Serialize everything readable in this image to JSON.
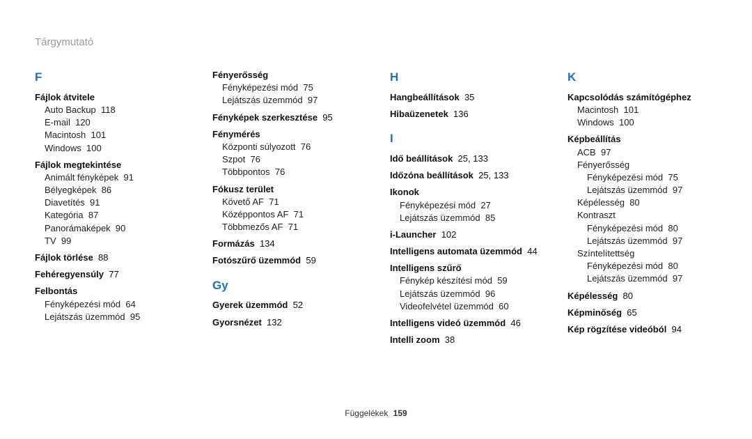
{
  "page_title": "Tárgymutató",
  "footer_label": "Függelékek",
  "footer_page": "159",
  "col1": {
    "letter": "F",
    "g1_head": "Fájlok átvitele",
    "g1_s1": "Auto Backup",
    "g1_s1p": "118",
    "g1_s2": "E-mail",
    "g1_s2p": "120",
    "g1_s3": "Macintosh",
    "g1_s3p": "101",
    "g1_s4": "Windows",
    "g1_s4p": "100",
    "g2_head": "Fájlok megtekintése",
    "g2_s1": "Animált fényképek",
    "g2_s1p": "91",
    "g2_s2": "Bélyegképek",
    "g2_s2p": "86",
    "g2_s3": "Diavetítés",
    "g2_s3p": "91",
    "g2_s4": "Kategória",
    "g2_s4p": "87",
    "g2_s5": "Panorámaképek",
    "g2_s5p": "90",
    "g2_s6": "TV",
    "g2_s6p": "99",
    "g3_head": "Fájlok törlése",
    "g3_p": "88",
    "g4_head": "Fehéregyensúly",
    "g4_p": "77",
    "g5_head": "Felbontás",
    "g5_s1": "Fényképezési mód",
    "g5_s1p": "64",
    "g5_s2": "Lejátszás üzemmód",
    "g5_s2p": "95"
  },
  "col2": {
    "g1_head": "Fényerősség",
    "g1_s1": "Fényképezési mód",
    "g1_s1p": "75",
    "g1_s2": "Lejátszás üzemmód",
    "g1_s2p": "97",
    "g2_head": "Fényképek szerkesztése",
    "g2_p": "95",
    "g3_head": "Fénymérés",
    "g3_s1": "Központi súlyozott",
    "g3_s1p": "76",
    "g3_s2": "Szpot",
    "g3_s2p": "76",
    "g3_s3": "Többpontos",
    "g3_s3p": "76",
    "g4_head": "Fókusz terület",
    "g4_s1": "Követő AF",
    "g4_s1p": "71",
    "g4_s2": "Középpontos AF",
    "g4_s2p": "71",
    "g4_s3": "Többmezős AF",
    "g4_s3p": "71",
    "g5_head": "Formázás",
    "g5_p": "134",
    "g6_head": "Fotószűrő üzemmód",
    "g6_p": "59",
    "letter": "Gy",
    "g7_head": "Gyerek üzemmód",
    "g7_p": "52",
    "g8_head": "Gyorsnézet",
    "g8_p": "132"
  },
  "col3": {
    "letter1": "H",
    "h1_head": "Hangbeállítások",
    "h1_p": "35",
    "h2_head": "Hibaüzenetek",
    "h2_p": "136",
    "letter2": "I",
    "i1_head": "Idő beállítások",
    "i1_p": "25, 133",
    "i2_head": "Időzóna beállítások",
    "i2_p": "25, 133",
    "i3_head": "Ikonok",
    "i3_s1": "Fényképezési mód",
    "i3_s1p": "27",
    "i3_s2": "Lejátszás üzemmód",
    "i3_s2p": "85",
    "i4_head": "i-Launcher",
    "i4_p": "102",
    "i5_head": "Intelligens automata üzemmód",
    "i5_p": "44",
    "i6_head": "Intelligens szűrő",
    "i6_s1": "Fénykép készítési mód",
    "i6_s1p": "59",
    "i6_s2": "Lejátszás üzemmód",
    "i6_s2p": "96",
    "i6_s3": "Videofelvétel üzemmód",
    "i6_s3p": "60",
    "i7_head": "Intelligens videó üzemmód",
    "i7_p": "46",
    "i8_head": "Intelli zoom",
    "i8_p": "38"
  },
  "col4": {
    "letter": "K",
    "k1_head": "Kapcsolódás számítógéphez",
    "k1_s1": "Macintosh",
    "k1_s1p": "101",
    "k1_s2": "Windows",
    "k1_s2p": "100",
    "k2_head": "Képbeállítás",
    "k2_s1": "ACB",
    "k2_s1p": "97",
    "k2_g1": "Fényerősség",
    "k2_g1_s1": "Fényképezési mód",
    "k2_g1_s1p": "75",
    "k2_g1_s2": "Lejátszás üzemmód",
    "k2_g1_s2p": "97",
    "k2_s2": "Képélesség",
    "k2_s2p": "80",
    "k2_g3": "Kontraszt",
    "k2_g3_s1": "Fényképezési mód",
    "k2_g3_s1p": "80",
    "k2_g3_s2": "Lejátszás üzemmód",
    "k2_g3_s2p": "97",
    "k2_g4": "Színtelítettség",
    "k2_g4_s1": "Fényképezési mód",
    "k2_g4_s1p": "80",
    "k2_g4_s2": "Lejátszás üzemmód",
    "k2_g4_s2p": "97",
    "k3_head": "Képélesség",
    "k3_p": "80",
    "k4_head": "Képminőség",
    "k4_p": "65",
    "k5_head": "Kép rögzítése videóból",
    "k5_p": "94"
  }
}
